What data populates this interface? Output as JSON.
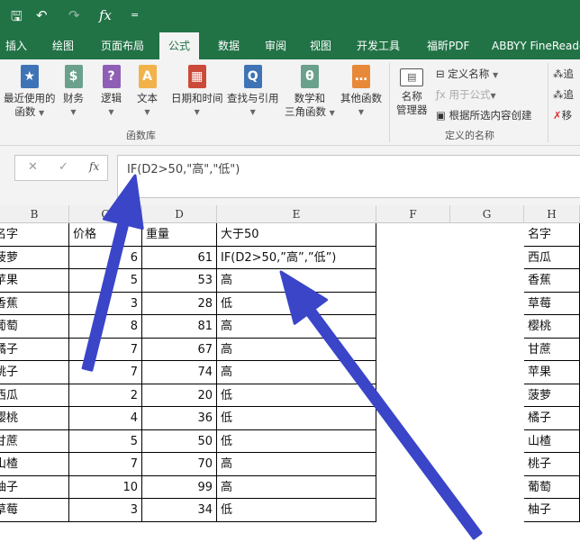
{
  "quick_access": {
    "save": "🖫",
    "undo": "↶",
    "redo": "↷",
    "fx": "fx",
    "customize": "="
  },
  "tabs": [
    "插入",
    "绘图",
    "页面布局",
    "公式",
    "数据",
    "审阅",
    "视图",
    "开发工具",
    "福昕PDF",
    "ABBYY FineReader"
  ],
  "active_tab": "公式",
  "ribbon": {
    "function_library": {
      "label": "函数库",
      "buttons": [
        {
          "label": "最近使用的",
          "label2": "函数",
          "color": "#3e74b5",
          "glyph": "★"
        },
        {
          "label": "财务",
          "color": "#6aa08c",
          "glyph": "$"
        },
        {
          "label": "逻辑",
          "color": "#8e5fb5",
          "glyph": "?"
        },
        {
          "label": "文本",
          "color": "#f2b24a",
          "glyph": "A"
        },
        {
          "label": "日期和时间",
          "color": "#cc4a3a",
          "glyph": "▦"
        },
        {
          "label": "查找与引用",
          "color": "#3e74b5",
          "glyph": "Q"
        },
        {
          "label": "数学和",
          "label2": "三角函数",
          "color": "#6aa08c",
          "glyph": "θ"
        },
        {
          "label": "其他函数",
          "color": "#e8893a",
          "glyph": "…"
        }
      ]
    },
    "defined_names": {
      "label": "定义的名称",
      "name_manager": "名称",
      "name_manager2": "管理器",
      "define_name": "定义名称",
      "use_in_formula": "用于公式",
      "create_from_selection": "根据所选内容创建"
    },
    "auditing": {
      "items": [
        "追",
        "追",
        "移"
      ]
    }
  },
  "formula_bar": {
    "cancel": "✕",
    "enter": "✓",
    "fx": "fx",
    "formula": "IF(D2>50,\"高\",\"低\")"
  },
  "columns": [
    "B",
    "C",
    "D",
    "E",
    "F",
    "G",
    "H"
  ],
  "table": {
    "headers": [
      "名字",
      "价格",
      "重量",
      "大于50"
    ],
    "rows": [
      [
        "菠萝",
        "6",
        "61",
        "IF(D2>50,”高”,”低”)"
      ],
      [
        "苹果",
        "5",
        "53",
        "高"
      ],
      [
        "香蕉",
        "3",
        "28",
        "低"
      ],
      [
        "葡萄",
        "8",
        "81",
        "高"
      ],
      [
        "橘子",
        "7",
        "67",
        "高"
      ],
      [
        "桃子",
        "7",
        "74",
        "高"
      ],
      [
        "西瓜",
        "2",
        "20",
        "低"
      ],
      [
        "樱桃",
        "4",
        "36",
        "低"
      ],
      [
        "甘蔗",
        "5",
        "50",
        "低"
      ],
      [
        "山楂",
        "7",
        "70",
        "高"
      ],
      [
        "柚子",
        "10",
        "99",
        "高"
      ],
      [
        "草莓",
        "3",
        "34",
        "低"
      ]
    ]
  },
  "h_column": {
    "header": "名字",
    "values": [
      "西瓜",
      "香蕉",
      "草莓",
      "樱桃",
      "甘蔗",
      "苹果",
      "菠萝",
      "橘子",
      "山楂",
      "桃子",
      "葡萄",
      "柚子"
    ]
  },
  "arrow_color": "#3a45c8"
}
